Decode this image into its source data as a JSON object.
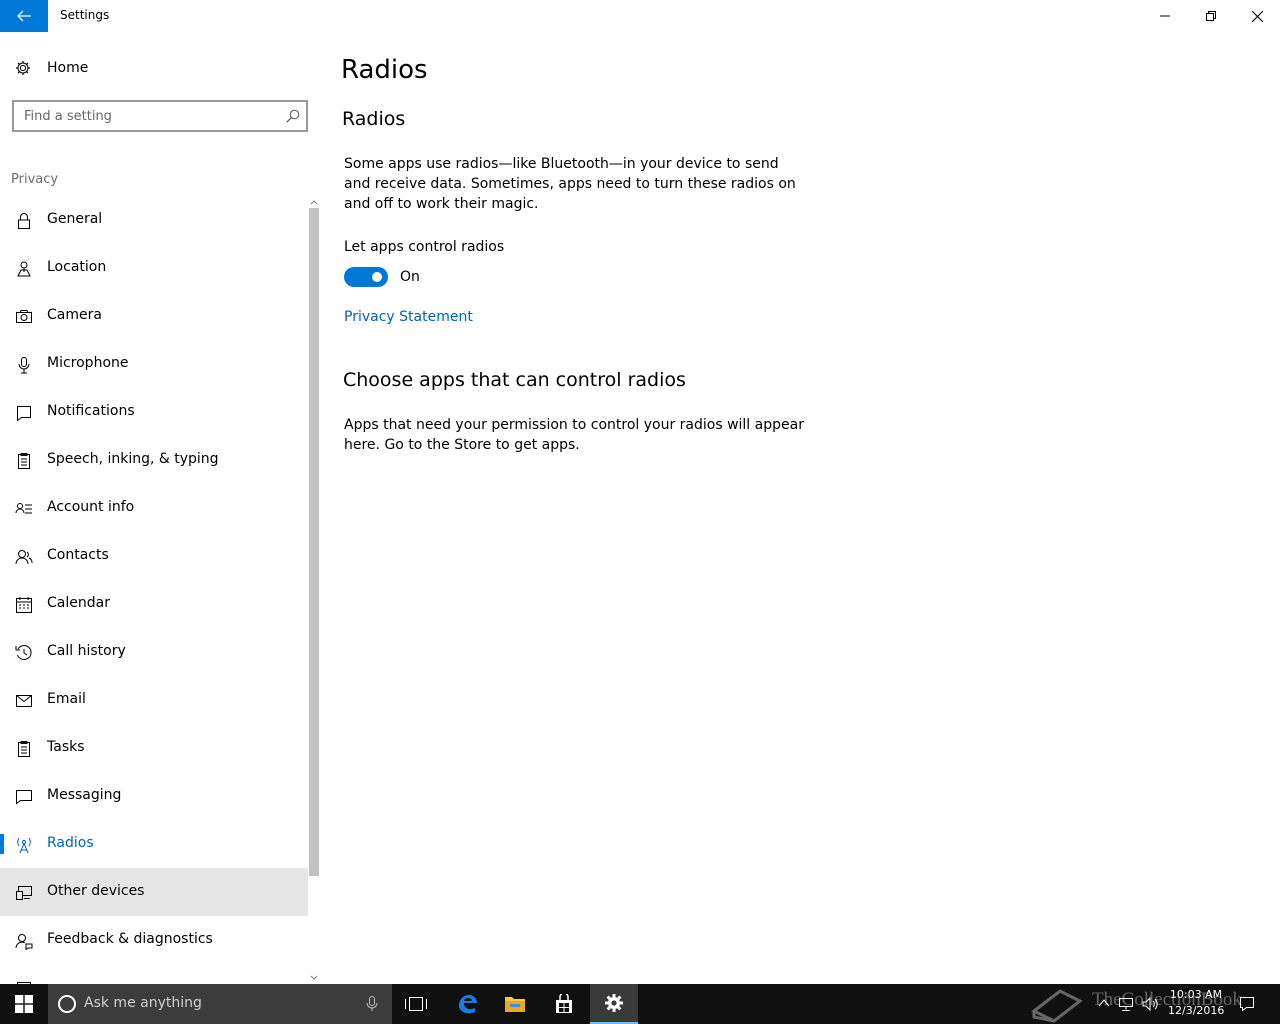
{
  "window": {
    "title": "Settings"
  },
  "sidebar": {
    "home_label": "Home",
    "search_placeholder": "Find a setting",
    "section_label": "Privacy",
    "items": [
      {
        "label": "General",
        "icon": "lock-icon"
      },
      {
        "label": "Location",
        "icon": "location-icon"
      },
      {
        "label": "Camera",
        "icon": "camera-icon"
      },
      {
        "label": "Microphone",
        "icon": "microphone-icon"
      },
      {
        "label": "Notifications",
        "icon": "notifications-icon"
      },
      {
        "label": "Speech, inking, & typing",
        "icon": "speech-icon"
      },
      {
        "label": "Account info",
        "icon": "account-info-icon"
      },
      {
        "label": "Contacts",
        "icon": "contacts-icon"
      },
      {
        "label": "Calendar",
        "icon": "calendar-icon"
      },
      {
        "label": "Call history",
        "icon": "call-history-icon"
      },
      {
        "label": "Email",
        "icon": "email-icon"
      },
      {
        "label": "Tasks",
        "icon": "tasks-icon"
      },
      {
        "label": "Messaging",
        "icon": "messaging-icon"
      },
      {
        "label": "Radios",
        "icon": "radios-icon",
        "selected": true
      },
      {
        "label": "Other devices",
        "icon": "other-devices-icon",
        "hover": true
      },
      {
        "label": "Feedback & diagnostics",
        "icon": "feedback-icon"
      }
    ]
  },
  "main": {
    "page_title": "Radios",
    "section1_title": "Radios",
    "description": "Some apps use radios—like Bluetooth—in your device to send and receive data. Sometimes, apps need to turn these radios on and off to work their magic.",
    "toggle_label": "Let apps control radios",
    "toggle_state": "On",
    "toggle_on": true,
    "privacy_link": "Privacy Statement",
    "section2_title": "Choose apps that can control radios",
    "section2_description": "Apps that need your permission to control your radios will appear here. Go to the Store to get apps."
  },
  "taskbar": {
    "search_placeholder": "Ask me anything",
    "clock_time": "10:03 AM",
    "clock_date": "12/3/2016",
    "watermark": "TheCollectionBook"
  },
  "colors": {
    "accent": "#0078d7",
    "link": "#0063b1",
    "taskbar": "#101010"
  }
}
